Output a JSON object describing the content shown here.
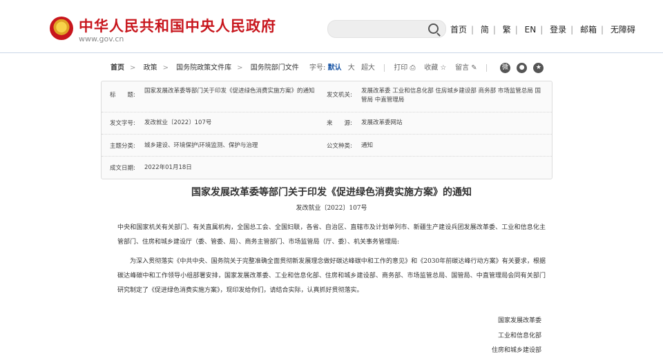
{
  "header": {
    "title": "中华人民共和国中央人民政府",
    "url": "www.gov.cn",
    "search_placeholder": "",
    "nav": [
      "首页",
      "简",
      "繁",
      "EN",
      "登录",
      "邮箱",
      "无障碍"
    ]
  },
  "breadcrumb": [
    "首页",
    "政策",
    "国务院政策文件库",
    "国务院部门文件"
  ],
  "tools": {
    "font_label": "字号:",
    "font_default": "默认",
    "font_large": "大",
    "font_xlarge": "超大",
    "print": "打印",
    "favorite": "收藏",
    "comment": "留言"
  },
  "meta": {
    "title_label": "标　　题:",
    "title_value": "国家发展改革委等部门关于印发《促进绿色消费实施方案》的通知",
    "issuer_label": "发文机关:",
    "issuer_value": "发展改革委  工业和信息化部  住房城乡建设部  商务部  市场监管总局  国管局  中直管理局",
    "docno_label": "发文字号:",
    "docno_value": "发改就业〔2022〕107号",
    "source_label": "来　　源:",
    "source_value": "发展改革委网站",
    "topic_label": "主题分类:",
    "topic_value": "城乡建设、环境保护\\环境监测、保护与治理",
    "type_label": "公文种类:",
    "type_value": "通知",
    "date_label": "成文日期:",
    "date_value": "2022年01月18日"
  },
  "document": {
    "title": "国家发展改革委等部门关于印发《促进绿色消费实施方案》的通知",
    "number": "发改就业〔2022〕107号",
    "recipients": "中央和国家机关有关部门、有关直属机构，全国总工会、全国妇联，各省、自治区、直辖市及计划单列市、新疆生产建设兵团发展改革委、工业和信息化主管部门、住房和城乡建设厅（委、管委、局）、商务主管部门、市场监管局（厅、委）、机关事务管理局:",
    "body": "为深入贯彻落实《中共中央、国务院关于完整准确全面贯彻新发展理念做好碳达峰碳中和工作的意见》和《2030年前碳达峰行动方案》有关要求，根据碳达峰碳中和工作领导小组部署安排，国家发展改革委、工业和信息化部、住房和城乡建设部、商务部、市场监管总局、国管局、中直管理局会同有关部门研究制定了《促进绿色消费实施方案》，现印发给你们，请结合实际，认真抓好贯彻落实。",
    "signatures": [
      "国家发展改革委",
      "工业和信息化部",
      "住房和城乡建设部"
    ]
  }
}
